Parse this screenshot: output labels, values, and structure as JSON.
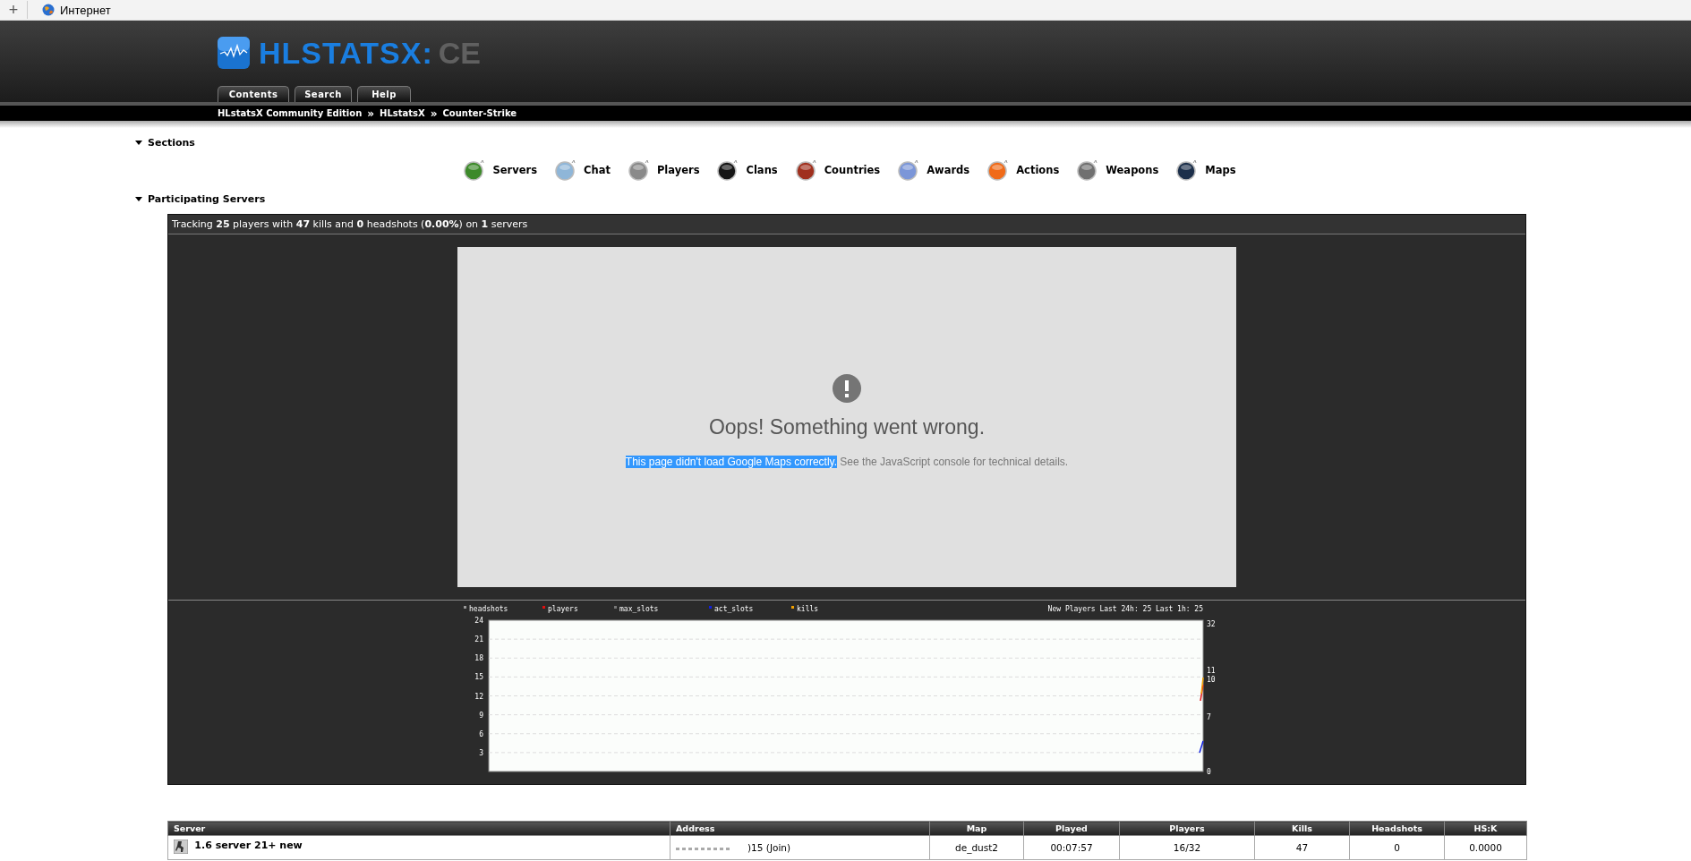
{
  "browser": {
    "new_tab": "+",
    "tab_title": "Интернет"
  },
  "header": {
    "logo_main": "HLSTATSX:",
    "logo_edition": "CE",
    "nav": [
      {
        "label": "Contents"
      },
      {
        "label": "Search"
      },
      {
        "label": "Help"
      }
    ],
    "breadcrumbs": [
      {
        "label": "HLstatsX Community Edition"
      },
      {
        "label": "HLstatsX"
      },
      {
        "label": "Counter-Strike"
      }
    ],
    "separator": "»"
  },
  "sections": {
    "title": "Sections",
    "expanded": true,
    "items": [
      {
        "label": "Servers"
      },
      {
        "label": "Chat"
      },
      {
        "label": "Players"
      },
      {
        "label": "Clans"
      },
      {
        "label": "Countries"
      },
      {
        "label": "Awards"
      },
      {
        "label": "Actions"
      },
      {
        "label": "Weapons"
      },
      {
        "label": "Maps"
      }
    ]
  },
  "participating": {
    "title": "Participating Servers",
    "expanded": true,
    "summary": "Tracking **25** players with **47** kills and **0** headshots (**0.00%**) on **1** servers",
    "map_error": {
      "title": "Oops! Something went wrong.",
      "message": [
        {
          "text": "This page didn't load Google Maps correctly.",
          "selected": true
        },
        {
          "text": "See the JavaScript console for technical details.",
          "selected": false
        }
      ]
    },
    "chart_note": "New Players Last 24h: 25 Last 1h: 25",
    "right_labels": [
      "32",
      "11",
      "10",
      "7",
      "0"
    ],
    "y_labels": [
      "24",
      "21",
      "18",
      "15",
      "12",
      "9",
      "6",
      "3"
    ],
    "legend": [
      {
        "name": "headshots",
        "color": "#999999"
      },
      {
        "name": "players",
        "color": "#e01010"
      },
      {
        "name": "max_slots",
        "color": "#777777"
      },
      {
        "name": "act_slots",
        "color": "#1020e0"
      },
      {
        "name": "kills",
        "color": "#f0a000"
      }
    ]
  },
  "table": {
    "columns": [
      "Server",
      "Address",
      "Map",
      "Played",
      "Players",
      "Kills",
      "Headshots",
      "HS:K"
    ],
    "rows": [
      {
        "server": "1.6 server 21+ new",
        "address": ")15 (Join)",
        "map": "de_dust2",
        "played": "00:07:57",
        "players": "16/32",
        "kills": "47",
        "headshots": "0",
        "hsk": "0.0000"
      }
    ]
  }
}
